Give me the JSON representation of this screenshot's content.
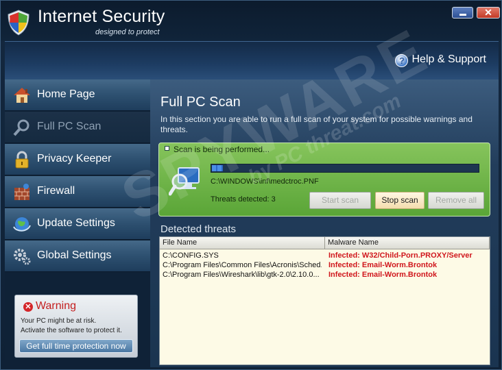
{
  "window": {
    "app_title": "Internet Security",
    "tagline": "designed to protect",
    "close_glyph": "✕"
  },
  "header": {
    "help_icon_glyph": "?",
    "help_label": "Help & Support"
  },
  "sidebar": {
    "items": [
      {
        "label": "Home Page",
        "icon": "house-icon",
        "active": false
      },
      {
        "label": "Full PC Scan",
        "icon": "magnifier-icon",
        "active": true
      },
      {
        "label": "Privacy Keeper",
        "icon": "padlock-icon",
        "active": false
      },
      {
        "label": "Firewall",
        "icon": "brick-wall-icon",
        "active": false
      },
      {
        "label": "Update Settings",
        "icon": "globe-update-icon",
        "active": false
      },
      {
        "label": "Global Settings",
        "icon": "gears-icon",
        "active": false
      }
    ],
    "warning": {
      "icon_glyph": "✕",
      "title": "Warning",
      "line1": "Your PC might be at risk.",
      "line2": "Activate the software to protect it.",
      "button": "Get full time protection now"
    }
  },
  "main": {
    "title": "Full PC Scan",
    "description": "In this section you are able to run a full scan of your system for possible warnings and threats.",
    "scan": {
      "status": "Scan is being performed...",
      "progress_fraction": 0.04,
      "current_file": "C:\\WINDOWS\\inf\\medctroc.PNF",
      "threats_detected": "Threats detected: 3",
      "start_label": "Start scan",
      "stop_label": "Stop scan",
      "remove_label": "Remove all"
    },
    "detected_title": "Detected threats",
    "table": {
      "headers": [
        "File Name",
        "Malware Name"
      ],
      "rows": [
        {
          "file": "C:\\CONFIG.SYS",
          "malware": "Infected: W32/Child-Porn.PROXY/Server"
        },
        {
          "file": "C:\\Program Files\\Common Files\\Acronis\\Sched...",
          "malware": "Infected: Email-Worm.Brontok"
        },
        {
          "file": "C:\\Program Files\\Wireshark\\lib\\gtk-2.0\\2.10.0...",
          "malware": "Infected: Email-Worm.Brontok"
        }
      ]
    }
  },
  "watermark": {
    "main": "SPYWARE",
    "sub": "by PC threat.com"
  },
  "colors": {
    "accent_green": "#6bb545",
    "threat_red": "#d0161c",
    "warning_red": "#c41e1e"
  }
}
